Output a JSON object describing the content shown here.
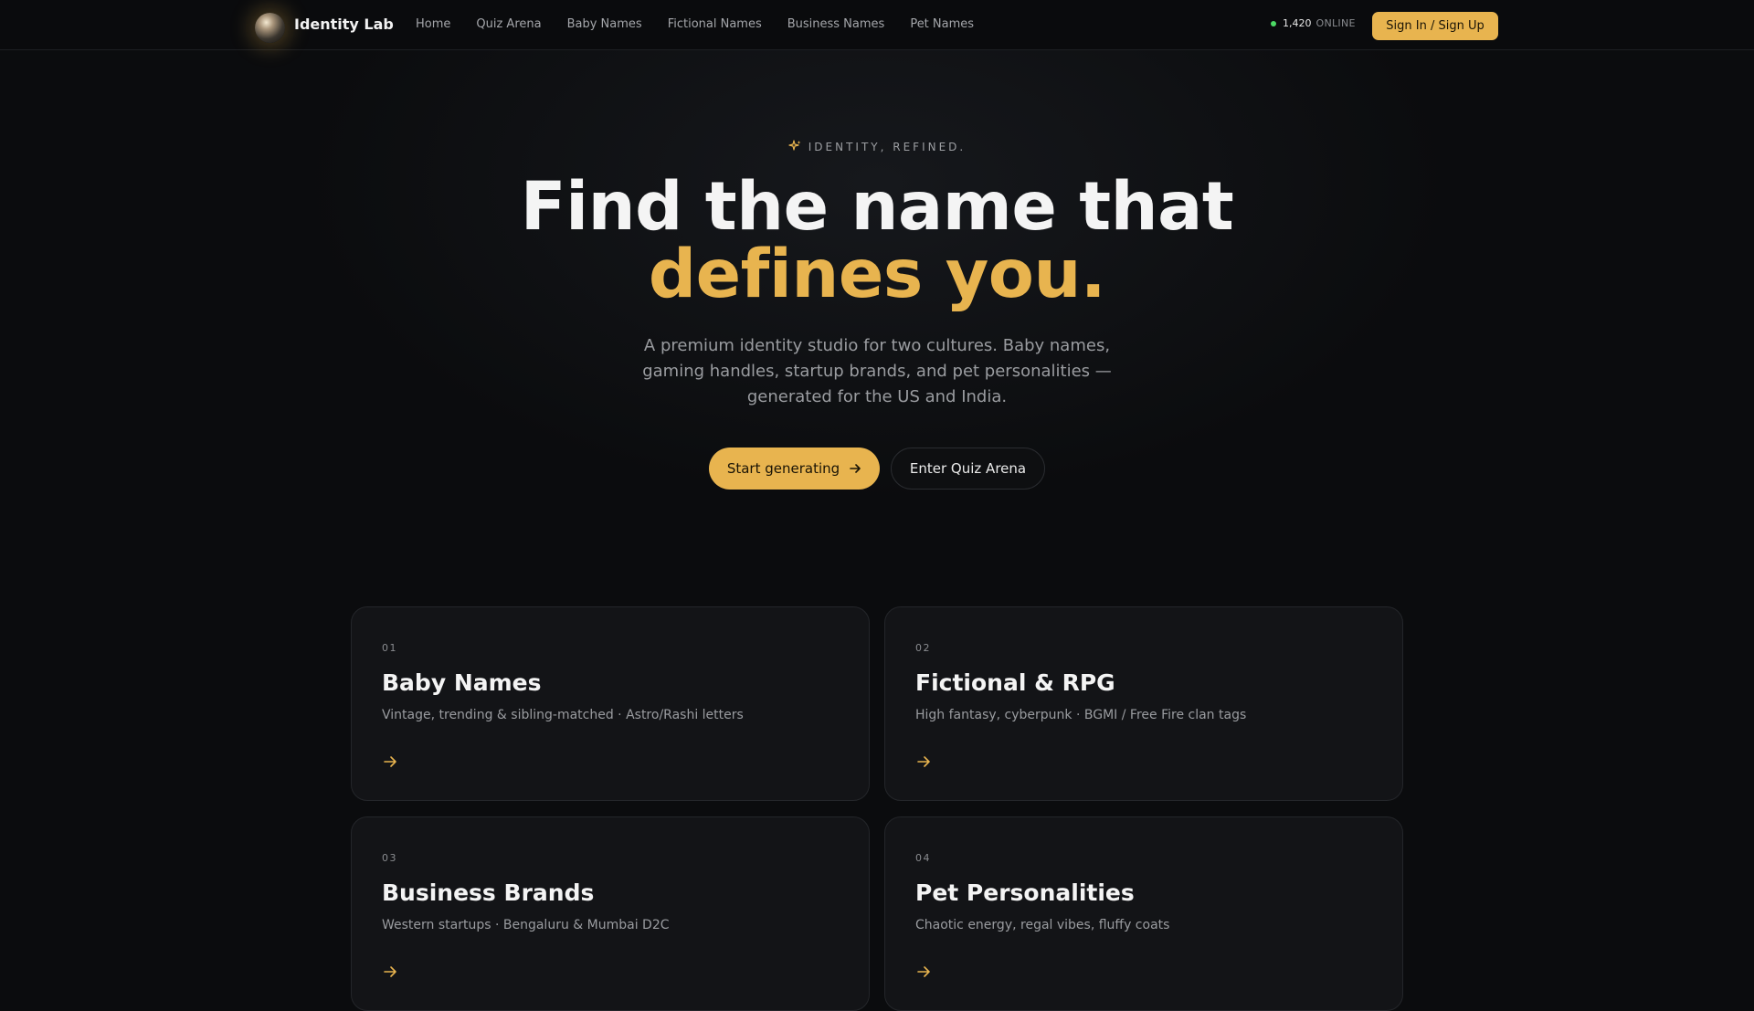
{
  "nav": {
    "brand": "Identity Lab",
    "links": [
      "Home",
      "Quiz Arena",
      "Baby Names",
      "Fictional Names",
      "Business Names",
      "Pet Names"
    ],
    "online_count": "1,420",
    "online_label": "ONLINE",
    "signin_label": "Sign In / Sign Up"
  },
  "hero": {
    "eyebrow": "IDENTITY, REFINED.",
    "title_line1": "Find the name that",
    "title_line2": "defines you.",
    "subtitle": "A premium identity studio for two cultures. Baby names, gaming handles, startup brands, and pet personalities — generated for the US and India.",
    "primary_cta": "Start generating",
    "secondary_cta": "Enter Quiz Arena"
  },
  "cards": [
    {
      "num": "01",
      "title": "Baby Names",
      "desc": "Vintage, trending & sibling-matched · Astro/Rashi letters"
    },
    {
      "num": "02",
      "title": "Fictional & RPG",
      "desc": "High fantasy, cyberpunk · BGMI / Free Fire clan tags"
    },
    {
      "num": "03",
      "title": "Business Brands",
      "desc": "Western startups · Bengaluru & Mumbai D2C"
    },
    {
      "num": "04",
      "title": "Pet Personalities",
      "desc": "Chaotic energy, regal vibes, fluffy coats"
    }
  ],
  "colors": {
    "accent": "#e8b44f",
    "background": "#0b0c0e",
    "card": "#131417",
    "online_dot": "#4cd964"
  },
  "icons": {
    "logo": "orb-logo-icon",
    "eyebrow": "sparkle-icon",
    "cta": "arrow-right-icon",
    "card": "arrow-right-icon"
  }
}
